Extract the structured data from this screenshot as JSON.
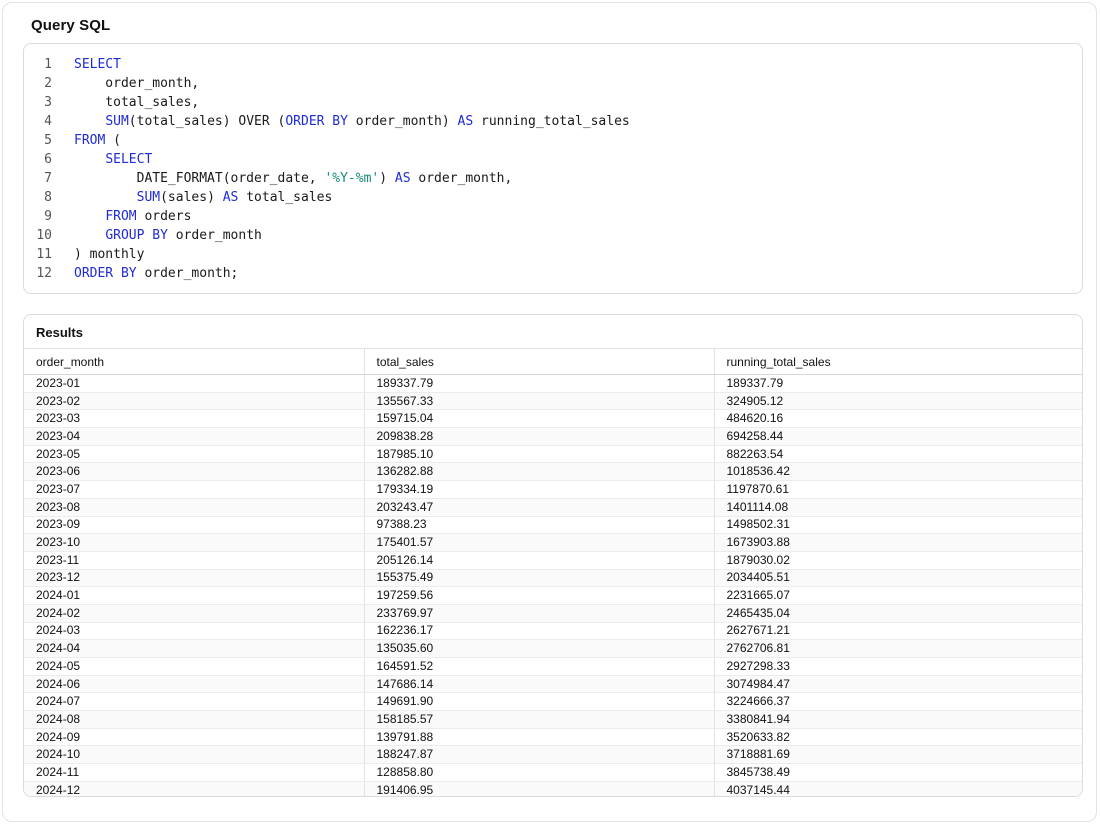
{
  "page": {
    "title": "Query SQL"
  },
  "code": {
    "lines": [
      {
        "n": "1",
        "tokens": [
          {
            "t": "SELECT",
            "c": "kw"
          }
        ]
      },
      {
        "n": "2",
        "tokens": [
          {
            "t": "    order_month,",
            "c": ""
          }
        ]
      },
      {
        "n": "3",
        "tokens": [
          {
            "t": "    total_sales,",
            "c": ""
          }
        ]
      },
      {
        "n": "4",
        "tokens": [
          {
            "t": "    ",
            "c": ""
          },
          {
            "t": "SUM",
            "c": "kw"
          },
          {
            "t": "(total_sales) OVER (",
            "c": ""
          },
          {
            "t": "ORDER BY",
            "c": "kw"
          },
          {
            "t": " order_month) ",
            "c": ""
          },
          {
            "t": "AS",
            "c": "kw"
          },
          {
            "t": " running_total_sales",
            "c": ""
          }
        ]
      },
      {
        "n": "5",
        "tokens": [
          {
            "t": "FROM",
            "c": "kw"
          },
          {
            "t": " (",
            "c": ""
          }
        ]
      },
      {
        "n": "6",
        "tokens": [
          {
            "t": "    ",
            "c": ""
          },
          {
            "t": "SELECT",
            "c": "kw"
          }
        ]
      },
      {
        "n": "7",
        "tokens": [
          {
            "t": "        DATE_FORMAT(order_date, ",
            "c": ""
          },
          {
            "t": "'%Y-%m'",
            "c": "str"
          },
          {
            "t": ") ",
            "c": ""
          },
          {
            "t": "AS",
            "c": "kw"
          },
          {
            "t": " order_month,",
            "c": ""
          }
        ]
      },
      {
        "n": "8",
        "tokens": [
          {
            "t": "        ",
            "c": ""
          },
          {
            "t": "SUM",
            "c": "kw"
          },
          {
            "t": "(sales) ",
            "c": ""
          },
          {
            "t": "AS",
            "c": "kw"
          },
          {
            "t": " total_sales",
            "c": ""
          }
        ]
      },
      {
        "n": "9",
        "tokens": [
          {
            "t": "    ",
            "c": ""
          },
          {
            "t": "FROM",
            "c": "kw"
          },
          {
            "t": " orders",
            "c": ""
          }
        ]
      },
      {
        "n": "10",
        "tokens": [
          {
            "t": "    ",
            "c": ""
          },
          {
            "t": "GROUP BY",
            "c": "kw"
          },
          {
            "t": " order_month",
            "c": ""
          }
        ]
      },
      {
        "n": "11",
        "tokens": [
          {
            "t": ") monthly",
            "c": ""
          }
        ]
      },
      {
        "n": "12",
        "tokens": [
          {
            "t": "ORDER BY",
            "c": "kw"
          },
          {
            "t": " order_month;",
            "c": ""
          }
        ]
      }
    ]
  },
  "results": {
    "title": "Results",
    "columns": [
      "order_month",
      "total_sales",
      "running_total_sales"
    ],
    "rows": [
      [
        "2023-01",
        "189337.79",
        "189337.79"
      ],
      [
        "2023-02",
        "135567.33",
        "324905.12"
      ],
      [
        "2023-03",
        "159715.04",
        "484620.16"
      ],
      [
        "2023-04",
        "209838.28",
        "694258.44"
      ],
      [
        "2023-05",
        "187985.10",
        "882263.54"
      ],
      [
        "2023-06",
        "136282.88",
        "1018536.42"
      ],
      [
        "2023-07",
        "179334.19",
        "1197870.61"
      ],
      [
        "2023-08",
        "203243.47",
        "1401114.08"
      ],
      [
        "2023-09",
        "97388.23",
        "1498502.31"
      ],
      [
        "2023-10",
        "175401.57",
        "1673903.88"
      ],
      [
        "2023-11",
        "205126.14",
        "1879030.02"
      ],
      [
        "2023-12",
        "155375.49",
        "2034405.51"
      ],
      [
        "2024-01",
        "197259.56",
        "2231665.07"
      ],
      [
        "2024-02",
        "233769.97",
        "2465435.04"
      ],
      [
        "2024-03",
        "162236.17",
        "2627671.21"
      ],
      [
        "2024-04",
        "135035.60",
        "2762706.81"
      ],
      [
        "2024-05",
        "164591.52",
        "2927298.33"
      ],
      [
        "2024-06",
        "147686.14",
        "3074984.47"
      ],
      [
        "2024-07",
        "149691.90",
        "3224666.37"
      ],
      [
        "2024-08",
        "158185.57",
        "3380841.94"
      ],
      [
        "2024-09",
        "139791.88",
        "3520633.82"
      ],
      [
        "2024-10",
        "188247.87",
        "3718881.69"
      ],
      [
        "2024-11",
        "128858.80",
        "3845738.49"
      ],
      [
        "2024-12",
        "191406.95",
        "4037145.44"
      ]
    ]
  },
  "colors": {
    "keyword": "#1f2bd6",
    "string": "#168a7a",
    "border": "#dcdcdc"
  }
}
